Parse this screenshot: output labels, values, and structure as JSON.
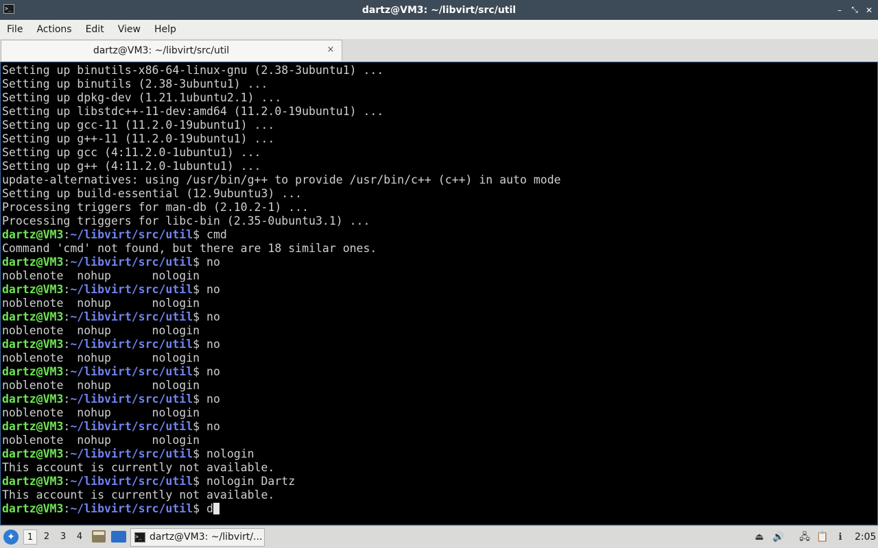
{
  "window": {
    "title": "dartz@VM3: ~/libvirt/src/util",
    "app_icon_glyph": ">_",
    "controls": [
      "–",
      "✕"
    ]
  },
  "menu": [
    "File",
    "Actions",
    "Edit",
    "View",
    "Help"
  ],
  "tab": {
    "label": "dartz@VM3: ~/libvirt/src/util",
    "close": "×"
  },
  "terminal": {
    "prompt_user": "dartz@VM3",
    "prompt_colon": ":",
    "prompt_path": "~/libvirt/src/util",
    "prompt_symbol": "$ ",
    "lines": [
      "Setting up binutils-x86-64-linux-gnu (2.38-3ubuntu1) ...",
      "Setting up binutils (2.38-3ubuntu1) ...",
      "Setting up dpkg-dev (1.21.1ubuntu2.1) ...",
      "Setting up libstdc++-11-dev:amd64 (11.2.0-19ubuntu1) ...",
      "Setting up gcc-11 (11.2.0-19ubuntu1) ...",
      "Setting up g++-11 (11.2.0-19ubuntu1) ...",
      "Setting up gcc (4:11.2.0-1ubuntu1) ...",
      "Setting up g++ (4:11.2.0-1ubuntu1) ...",
      "update-alternatives: using /usr/bin/g++ to provide /usr/bin/c++ (c++) in auto mode",
      "Setting up build-essential (12.9ubuntu3) ...",
      "Processing triggers for man-db (2.10.2-1) ...",
      "Processing triggers for libc-bin (2.35-0ubuntu3.1) ...",
      "$cmd",
      "Command 'cmd' not found, but there are 18 similar ones.",
      "$no",
      "noblenote  nohup      nologin",
      "$no",
      "noblenote  nohup      nologin",
      "$no",
      "noblenote  nohup      nologin",
      "$no",
      "noblenote  nohup      nologin",
      "$no",
      "noblenote  nohup      nologin",
      "$no",
      "noblenote  nohup      nologin",
      "$no",
      "noblenote  nohup      nologin",
      "$nologin",
      "This account is currently not available.",
      "$nologin Dartz",
      "This account is currently not available.",
      "$d"
    ]
  },
  "taskbar": {
    "desktops": [
      "1",
      "2",
      "3",
      "4"
    ],
    "active_desktop": "1",
    "task_label": "dartz@VM3: ~/libvirt/...",
    "clock": "2:05"
  }
}
